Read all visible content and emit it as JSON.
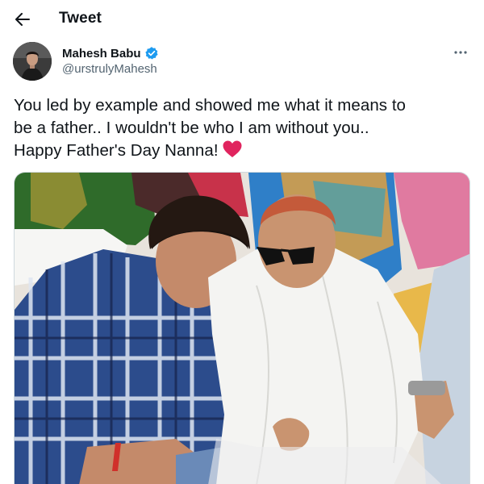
{
  "header": {
    "title": "Tweet",
    "back_icon": "arrow-left-icon"
  },
  "author": {
    "display_name": "Mahesh Babu",
    "handle": "@urstrulyMahesh",
    "verified": true,
    "verified_color": "#1d9bf0",
    "more_icon": "ellipsis-icon"
  },
  "tweet": {
    "lines": [
      "You led by example and showed me what it means to",
      "be a father.. I wouldn't be who I am without you..",
      "Happy Father's Day Nanna!"
    ],
    "emoji": "red-heart-icon",
    "heart_color": "#e0245e"
  },
  "media": {
    "type": "photo",
    "border_color": "#cfd9de"
  },
  "colors": {
    "text_primary": "#0f1419",
    "text_secondary": "#536471",
    "background": "#ffffff"
  }
}
